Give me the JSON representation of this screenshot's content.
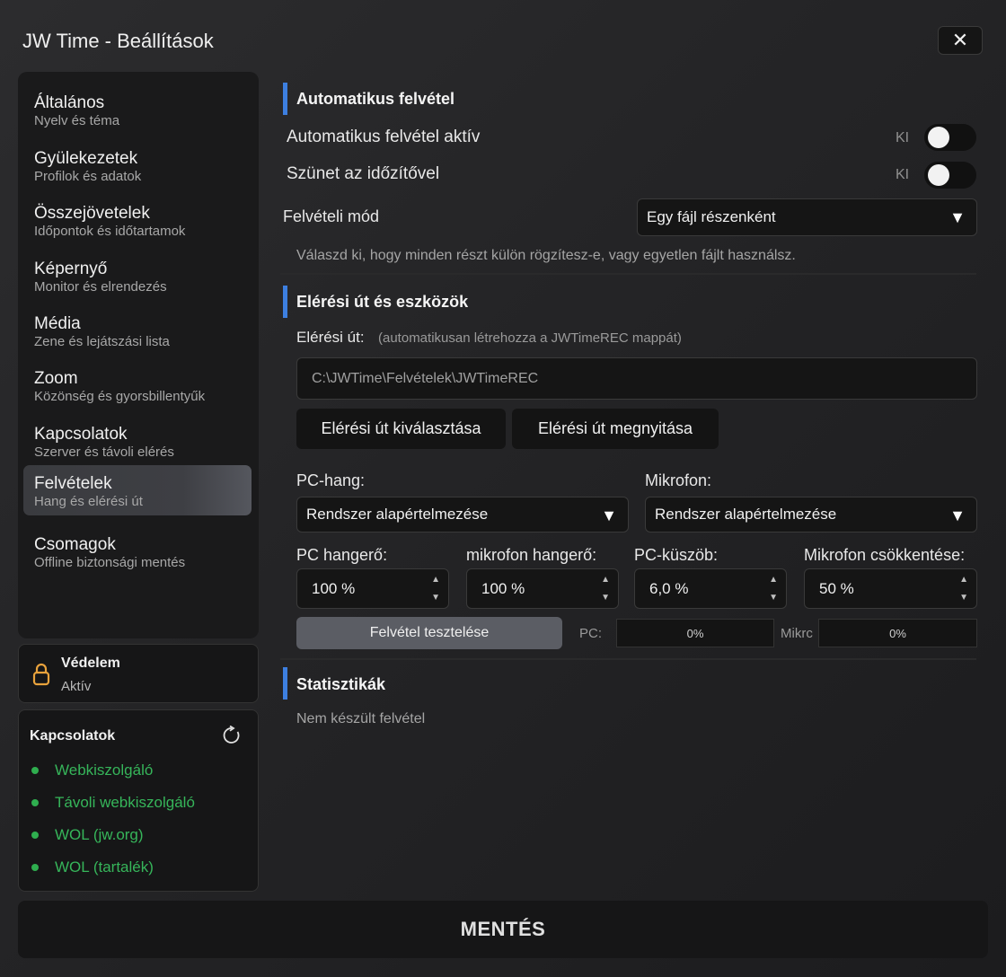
{
  "window": {
    "title": "JW Time - Beállítások",
    "close_label": "✕"
  },
  "nav": {
    "items": [
      {
        "label": "Általános",
        "sub": "Nyelv és téma"
      },
      {
        "label": "Gyülekezetek",
        "sub": "Profilok és adatok"
      },
      {
        "label": "Összejövetelek",
        "sub": "Időpontok és időtartamok"
      },
      {
        "label": "Képernyő",
        "sub": "Monitor és elrendezés"
      },
      {
        "label": "Média",
        "sub": "Zene és lejátszási lista"
      },
      {
        "label": "Zoom",
        "sub": "Közönség és gyorsbillentyűk"
      },
      {
        "label": "Kapcsolatok",
        "sub": "Szerver és távoli elérés"
      },
      {
        "label": "Felvételek",
        "sub": "Hang és elérési út",
        "active": true
      },
      {
        "label": "Csomagok",
        "sub": "Offline biztonsági mentés"
      }
    ]
  },
  "protection": {
    "title": "Védelem",
    "status": "Aktív",
    "icon": "lock-icon",
    "accent": "#e8a23c"
  },
  "connections": {
    "title": "Kapcsolatok",
    "status_color": "#36b55a",
    "items": [
      {
        "label": "Webkiszolgáló"
      },
      {
        "label": "Távoli webkiszolgáló"
      },
      {
        "label": "WOL (jw.org)"
      },
      {
        "label": "WOL (tartalék)"
      }
    ]
  },
  "auto_record": {
    "title": "Automatikus felvétel",
    "active_label": "Automatikus felvétel aktív",
    "active_state": "KI",
    "pause_label": "Szünet az időzítővel",
    "pause_state": "KI",
    "mode_label": "Felvételi mód",
    "mode_value": "Egy fájl részenként",
    "hint": "Válaszd ki, hogy minden részt külön rögzítesz-e, vagy egyetlen fájlt használsz."
  },
  "paths": {
    "title": "Elérési út és eszközök",
    "path_label": "Elérési út:",
    "path_note": "(automatikusan létrehozza a JWTimeREC mappát)",
    "path_value": "C:\\JWTime\\Felvételek\\JWTimeREC",
    "choose_button": "Elérési út kiválasztása",
    "open_button": "Elérési út megnyitása",
    "pc_audio_label": "PC-hang:",
    "pc_audio_value": "Rendszer alapértelmezése",
    "mic_label": "Mikrofon:",
    "mic_value": "Rendszer alapértelmezése",
    "pc_volume_label": "PC hangerő:",
    "pc_volume_value": "100 %",
    "mic_volume_label": "mikrofon hangerő:",
    "mic_volume_value": "100 %",
    "pc_threshold_label": "PC-küszöb:",
    "pc_threshold_value": "6,0 %",
    "mic_reduction_label": "Mikrofon csökkentése:",
    "mic_reduction_value": "50 %",
    "test_button": "Felvétel tesztelése",
    "pc_meter_label": "PC:",
    "pc_meter_value": "0%",
    "mic_meter_label": "Mikrc",
    "mic_meter_value": "0%"
  },
  "stats": {
    "title": "Statisztikák",
    "text": "Nem készült felvétel"
  },
  "save_button": "MENTÉS"
}
